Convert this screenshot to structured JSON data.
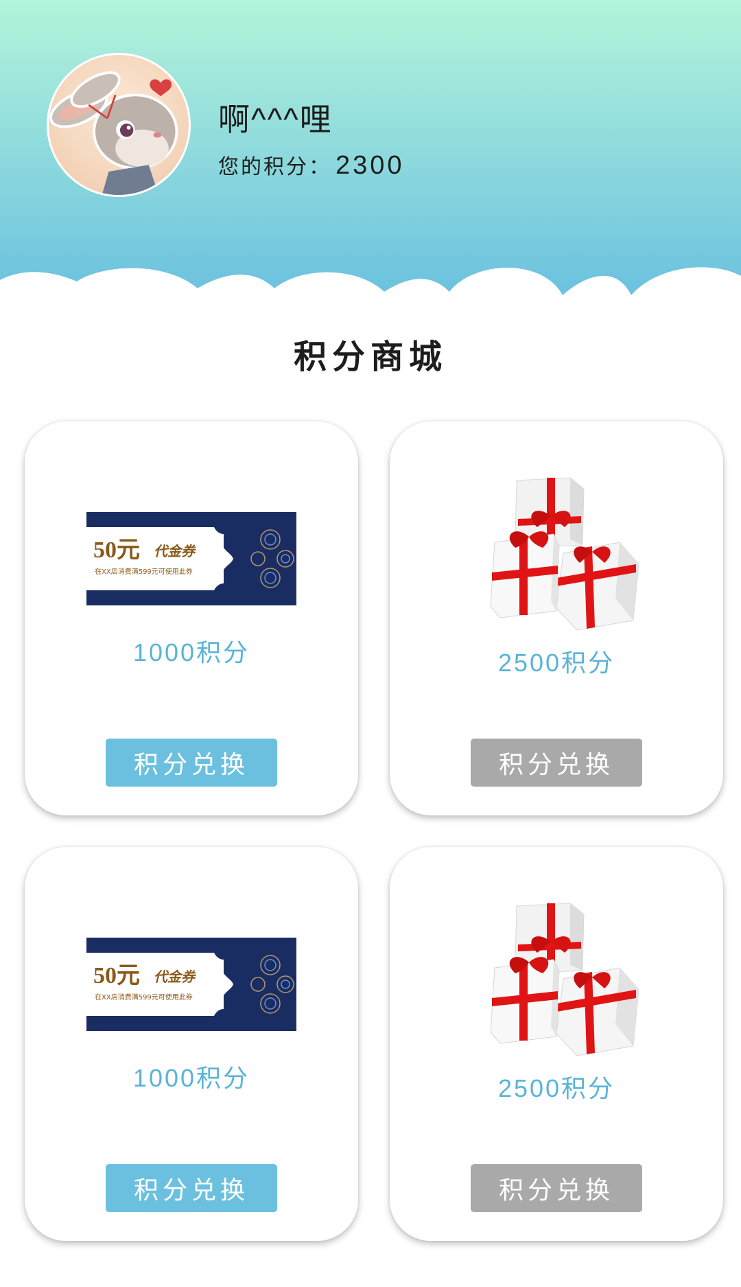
{
  "profile": {
    "username": "啊^^^哩",
    "points_label": "您的积分：",
    "points_value": "2300"
  },
  "shop": {
    "title": "积分商城",
    "items": [
      {
        "image": "voucher-image",
        "voucher_amount": "50元",
        "voucher_title": "代金券",
        "voucher_note": "在XX店消费满599元可使用此券",
        "price": "1000积分",
        "button_label": "积分兑换",
        "button_state": "enabled"
      },
      {
        "image": "gift-boxes-image",
        "price": "2500积分",
        "button_label": "积分兑换",
        "button_state": "disabled"
      },
      {
        "image": "voucher-image",
        "voucher_amount": "50元",
        "voucher_title": "代金券",
        "voucher_note": "在XX店消费满599元可使用此券",
        "price": "1000积分",
        "button_label": "积分兑换",
        "button_state": "enabled"
      },
      {
        "image": "gift-boxes-image",
        "price": "2500积分",
        "button_label": "积分兑换",
        "button_state": "disabled"
      }
    ]
  },
  "colors": {
    "header_gradient_top": "#b3f4da",
    "header_gradient_bottom": "#6bc1df",
    "accent": "#5ab4d8",
    "button_enabled": "#6cc0df",
    "button_disabled": "#a9a9a9"
  }
}
